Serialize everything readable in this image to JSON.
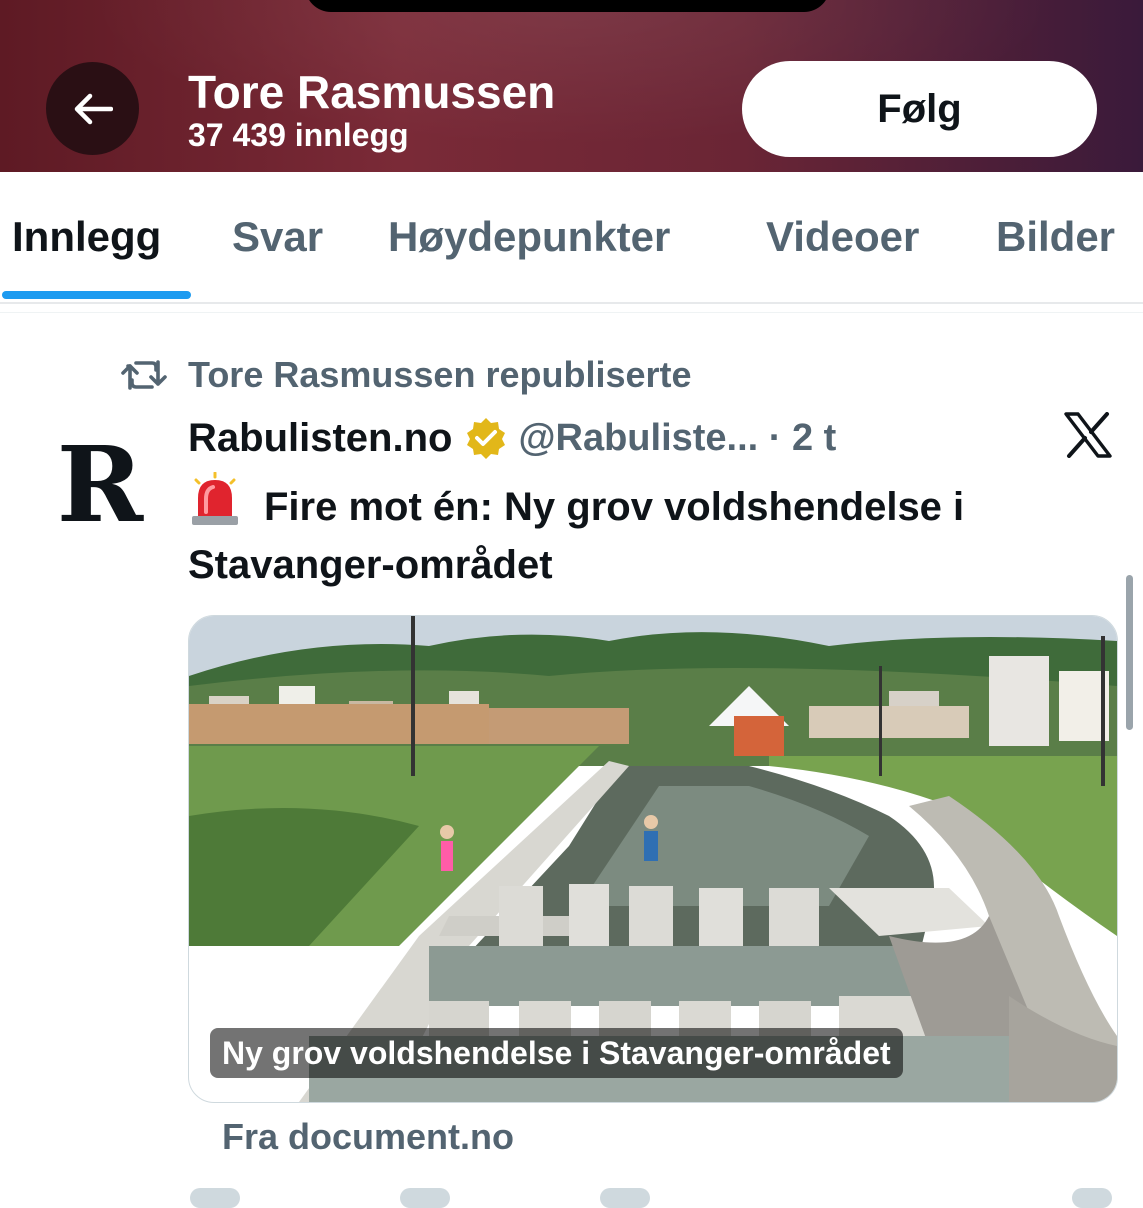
{
  "header": {
    "name": "Tore Rasmussen",
    "post_count": "37 439 innlegg",
    "follow_label": "Følg"
  },
  "tabs": [
    {
      "label": "Innlegg",
      "active": true
    },
    {
      "label": "Svar",
      "active": false
    },
    {
      "label": "Høydepunkter",
      "active": false
    },
    {
      "label": "Videoer",
      "active": false
    },
    {
      "label": "Bilder",
      "active": false
    }
  ],
  "post": {
    "repost_text": "Tore Rasmussen republiserte",
    "avatar_letter": "R",
    "author_name": "Rabulisten.no",
    "handle_time": "@Rabuliste... · 2 t",
    "text": "Fire mot én: Ny grov voldshendelse i Stavanger-området",
    "card": {
      "caption": "Ny grov voldshendelse i Stavanger-området",
      "source": "Fra document.no"
    }
  },
  "colors": {
    "accent": "#1d9bf0",
    "verified_gold": "#e2b719",
    "secondary_text": "#536471"
  },
  "icons": [
    "back-arrow-icon",
    "repost-icon",
    "verified-badge-icon",
    "x-logo-icon",
    "siren-emoji-icon"
  ]
}
